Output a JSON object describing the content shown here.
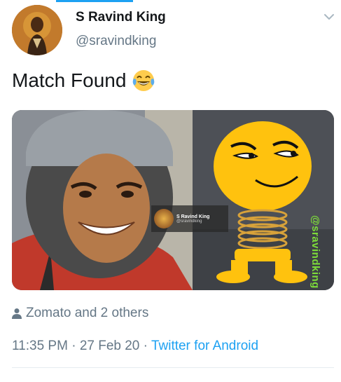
{
  "tweet": {
    "author_name": "S Ravind King",
    "author_handle": "@sravindking",
    "text": "Match Found",
    "text_emoji": "face-with-tears-of-joy",
    "likes_text": "Zomato and 2 others",
    "time": "11:35 PM",
    "date": "27 Feb 20",
    "source": "Twitter for Android",
    "separator": "·"
  },
  "media": {
    "watermark_name": "S Ravind King",
    "watermark_handle": "@sravindking",
    "vertical_watermark": "@sravindking"
  },
  "colors": {
    "accent": "#1da1f2",
    "secondary_text": "#657786",
    "primary_text": "#14171a",
    "watermark_green": "#7ddc3a"
  }
}
